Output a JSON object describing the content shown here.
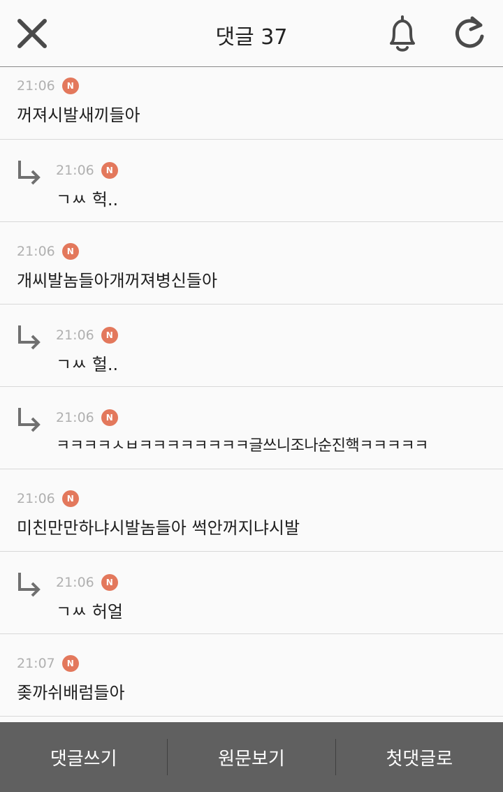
{
  "header": {
    "title": "댓글 37",
    "close_icon": "close-icon",
    "bell_icon": "bell-icon",
    "refresh_icon": "refresh-icon"
  },
  "colors": {
    "badge": "#e3785c",
    "bottom_bar": "#606060",
    "time_text": "#b0b0b0"
  },
  "comments": [
    {
      "time": "21:06",
      "badge": "N",
      "text": "꺼져시발새끼들아",
      "reply": false
    },
    {
      "time": "21:06",
      "badge": "N",
      "text": "ㄱㅆ 헉..",
      "reply": true
    },
    {
      "time": "21:06",
      "badge": "N",
      "text": "개씨발놈들아개꺼져병신들아",
      "reply": false
    },
    {
      "time": "21:06",
      "badge": "N",
      "text": "ㄱㅆ 헐..",
      "reply": true
    },
    {
      "time": "21:06",
      "badge": "N",
      "text": "ㅋㅋㅋㅋㅅㅂㅋㅋㅋㅋㅋㅋㅋㅋ글쓰니조나순진핵ㅋㅋㅋㅋㅋ",
      "reply": true
    },
    {
      "time": "21:06",
      "badge": "N",
      "text": "미친만만하냐시발놈들아 썩안꺼지냐시발",
      "reply": false
    },
    {
      "time": "21:06",
      "badge": "N",
      "text": "ㄱㅆ 허얼",
      "reply": true
    },
    {
      "time": "21:07",
      "badge": "N",
      "text": "좆까쉬배럼들아",
      "reply": false
    }
  ],
  "bottom_bar": {
    "write_label": "댓글쓰기",
    "original_label": "원문보기",
    "first_label": "첫댓글로"
  }
}
